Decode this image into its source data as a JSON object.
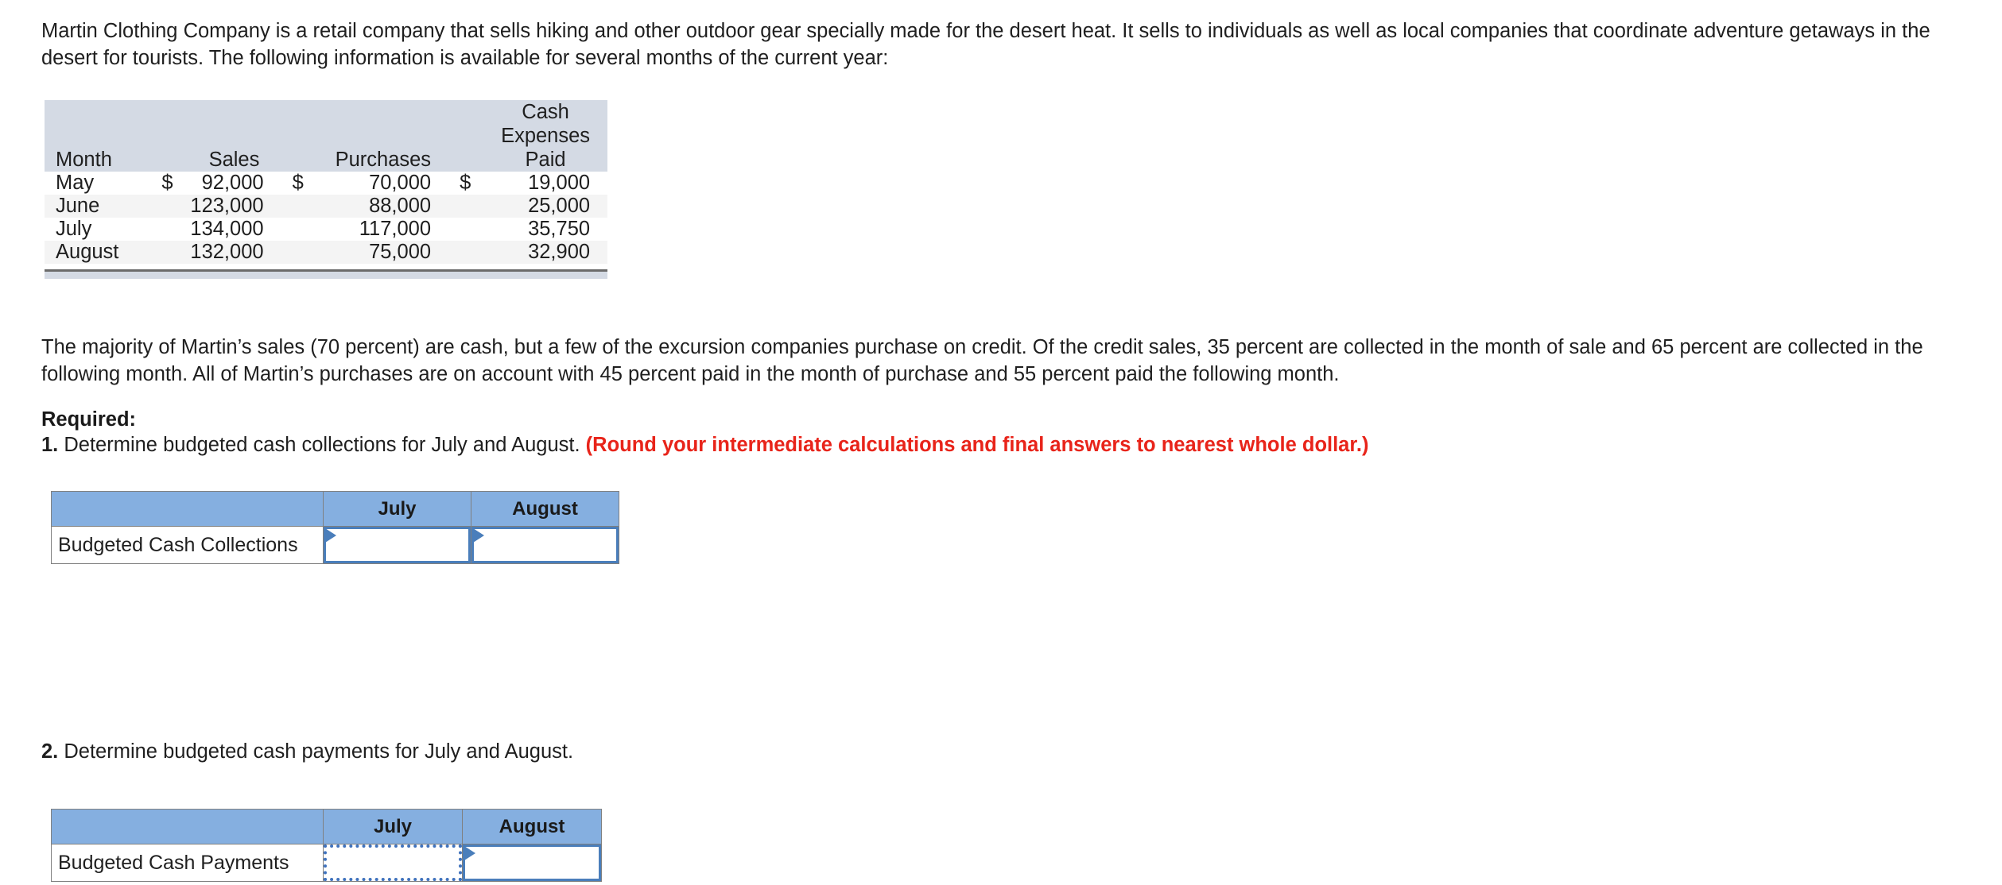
{
  "intro": {
    "paragraph": "Martin Clothing Company is a retail company that sells hiking and other outdoor gear specially made for the desert heat. It sells to individuals as well as local companies that coordinate adventure getaways in the desert for tourists. The following information is available for several months of the current year:"
  },
  "data_table": {
    "headers": [
      "Month",
      "Sales",
      "Purchases",
      "Cash Expenses Paid"
    ],
    "header_lines": {
      "month": "Month",
      "sales": "Sales",
      "purchases": "Purchases",
      "cash_line1": "Cash",
      "cash_line2": "Expenses",
      "cash_line3": "Paid"
    },
    "rows": [
      {
        "month": "May",
        "sales_currency": "$",
        "sales": "92,000",
        "purchases_currency": "$",
        "purchases": "70,000",
        "cash_currency": "$",
        "cash_expenses_paid": "19,000"
      },
      {
        "month": "June",
        "sales_currency": "",
        "sales": "123,000",
        "purchases_currency": "",
        "purchases": "88,000",
        "cash_currency": "",
        "cash_expenses_paid": "25,000"
      },
      {
        "month": "July",
        "sales_currency": "",
        "sales": "134,000",
        "purchases_currency": "",
        "purchases": "117,000",
        "cash_currency": "",
        "cash_expenses_paid": "35,750"
      },
      {
        "month": "August",
        "sales_currency": "",
        "sales": "132,000",
        "purchases_currency": "",
        "purchases": "75,000",
        "cash_currency": "",
        "cash_expenses_paid": "32,900"
      }
    ]
  },
  "paragraph2": {
    "text": "The majority of Martin’s sales (70 percent) are cash, but a few of the excursion companies purchase on credit. Of the credit sales, 35 percent are collected in the month of sale and 65 percent are collected in the following month. All of Martin’s purchases are on account with 45 percent paid in the month of purchase and 55 percent paid the following month."
  },
  "required": {
    "label": "Required:",
    "item1_number": "1.",
    "item1_text": " Determine budgeted cash collections for July and August. ",
    "item1_rounding_note": "(Round your intermediate calculations and final answers to nearest whole dollar.)",
    "item2_number": "2.",
    "item2_text": " Determine budgeted cash payments for July and August."
  },
  "answer_table_1": {
    "blank_header": "",
    "col_july": "July",
    "col_august": "August",
    "row_label": "Budgeted Cash Collections",
    "july_value": "",
    "august_value": ""
  },
  "answer_table_2": {
    "blank_header": "",
    "col_july": "July",
    "col_august": "August",
    "row_label": "Budgeted Cash Payments",
    "july_value": "",
    "august_value": ""
  },
  "colors": {
    "data_header_bg": "#d4dae4",
    "data_alt_row_bg": "#f4f4f4",
    "answer_header_bg": "#85afe0",
    "input_border_blue": "#4a7ebb",
    "selected_dotted_blue": "#3f72bd",
    "rounding_note_red": "#e8241a",
    "table_border_gray": "#808080"
  }
}
